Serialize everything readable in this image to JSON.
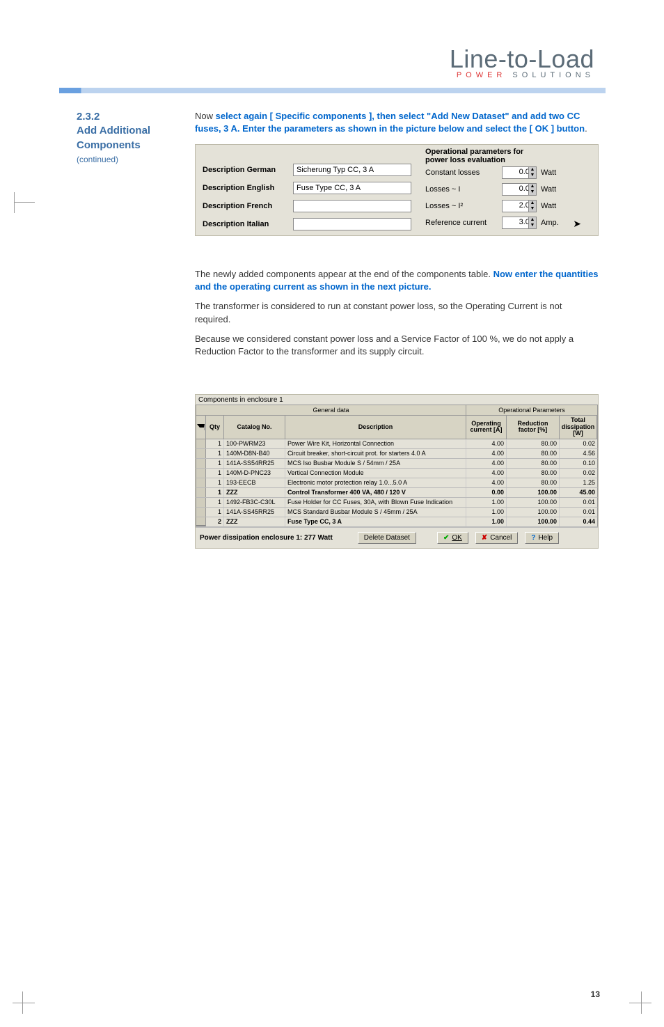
{
  "logo": {
    "main": "Line-to-Load",
    "sub_left": "POWER",
    "sub_right": " SOLUTIONS"
  },
  "sidebar": {
    "num": "2.3.2",
    "title_l1": "Add Additional",
    "title_l2": "Components",
    "cont": "(continued)"
  },
  "intro": {
    "lead": "Now ",
    "blue": "select again [ Specific components ], then select \"Add New Dataset\" and add two CC fuses, 3 A. Enter the parameters as shown in the picture below and select the [ OK ] button",
    "tail": "."
  },
  "ops": {
    "title": "Operational parameters for power loss evaluation",
    "left_labels": {
      "de": "Description German",
      "en": "Description English",
      "fr": "Description French",
      "it": "Description Italian"
    },
    "left_values": {
      "de": "Sicherung Typ CC, 3 A",
      "en": "Fuse Type CC, 3 A",
      "fr": "",
      "it": ""
    },
    "rows": [
      {
        "label": "Constant losses",
        "value": "0.00",
        "unit": "Watt"
      },
      {
        "label": "Losses ~ I",
        "value": "0.00",
        "unit": "Watt"
      },
      {
        "label": "Losses ~ I²",
        "value": "2.00",
        "unit": "Watt"
      },
      {
        "label": "Reference current",
        "value": "3.00",
        "unit": "Amp."
      }
    ]
  },
  "body": {
    "p1a": "The newly added components appear at the end of the components table. ",
    "p1b": "Now enter the quantities and the operating current as shown in the next picture.",
    "p2": "The transformer is considered to run at constant power loss, so the Operating Current is not required.",
    "p3": "Because we considered constant power loss and a Service Factor of 100 %, we do not apply a Reduction Factor to the transformer and its supply circuit."
  },
  "table": {
    "enclosure_label": "Components in enclosure 1",
    "group1": "General data",
    "group2": "Operational Parameters",
    "head": {
      "qty": "Qty",
      "cat": "Catalog No.",
      "desc": "Description",
      "op": "Operating current [A]",
      "red": "Reduction factor [%]",
      "tot": "Total dissipation [W]"
    },
    "rows": [
      {
        "bold": false,
        "qty": "1",
        "cat": "100-PWRM23",
        "desc": "Power Wire Kit, Horizontal Connection",
        "op": "4.00",
        "red": "80.00",
        "tot": "0.02"
      },
      {
        "bold": false,
        "qty": "1",
        "cat": "140M-D8N-B40",
        "desc": "Circuit breaker, short-circuit prot. for starters  4.0 A",
        "op": "4.00",
        "red": "80.00",
        "tot": "4.56"
      },
      {
        "bold": false,
        "qty": "1",
        "cat": "141A-SS54RR25",
        "desc": "MCS Iso Busbar Module S / 54mm / 25A",
        "op": "4.00",
        "red": "80.00",
        "tot": "0.10"
      },
      {
        "bold": false,
        "qty": "1",
        "cat": "140M-D-PNC23",
        "desc": "Vertical Connection Module",
        "op": "4.00",
        "red": "80.00",
        "tot": "0.02"
      },
      {
        "bold": false,
        "qty": "1",
        "cat": "193-EECB",
        "desc": "Electronic motor protection relay 1.0...5.0 A",
        "op": "4.00",
        "red": "80.00",
        "tot": "1.25"
      },
      {
        "bold": true,
        "qty": "1",
        "cat": "ZZZ",
        "desc": "Control Transformer 400 VA, 480 / 120 V",
        "op": "0.00",
        "red": "100.00",
        "tot": "45.00"
      },
      {
        "bold": false,
        "qty": "1",
        "cat": "1492-FB3C-C30L",
        "desc": "Fuse Holder for CC Fuses, 30A, with Blown Fuse Indication",
        "op": "1.00",
        "red": "100.00",
        "tot": "0.01"
      },
      {
        "bold": false,
        "qty": "1",
        "cat": "141A-SS45RR25",
        "desc": "MCS Standard Busbar Module S / 45mm / 25A",
        "op": "1.00",
        "red": "100.00",
        "tot": "0.01"
      },
      {
        "bold": true,
        "qty": "2",
        "cat": "ZZZ",
        "desc": "Fuse Type CC, 3 A",
        "op": "1.00",
        "red": "100.00",
        "tot": "0.44"
      }
    ],
    "footer": {
      "pd": "Power dissipation enclosure 1:  277 Watt",
      "del": "Delete Dataset",
      "ok": "OK",
      "cancel": "Cancel",
      "help": "Help"
    }
  },
  "page_num": "13"
}
